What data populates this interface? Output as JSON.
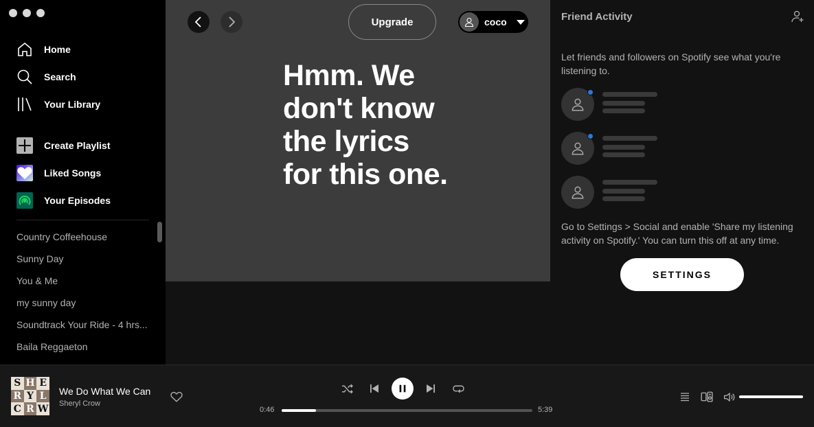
{
  "sidebar": {
    "nav": [
      {
        "label": "Home",
        "icon": "home-icon"
      },
      {
        "label": "Search",
        "icon": "search-icon"
      },
      {
        "label": "Your Library",
        "icon": "library-icon"
      }
    ],
    "actions": [
      {
        "label": "Create Playlist",
        "icon": "plus-icon"
      },
      {
        "label": "Liked Songs",
        "icon": "heart-icon"
      },
      {
        "label": "Your Episodes",
        "icon": "podcast-icon"
      }
    ],
    "playlists": [
      "Country Coffeehouse",
      "Sunny Day",
      "You & Me",
      "my sunny day",
      "Soundtrack Your Ride - 4 hrs...",
      "Baila Reggaeton"
    ]
  },
  "header": {
    "upgrade_label": "Upgrade",
    "user_name": "coco"
  },
  "main": {
    "no_lyrics_message": "Hmm. We don't know the lyrics for this one."
  },
  "friend_activity": {
    "title": "Friend Activity",
    "intro": "Let friends and followers on Spotify see what you're listening to.",
    "outro": "Go to Settings > Social and enable 'Share my listening activity on Spotify.' You can turn this off at any time.",
    "settings_label": "SETTINGS"
  },
  "player": {
    "track_title": "We Do What We Can",
    "artist": "Sheryl Crow",
    "cover_letters": [
      "S",
      "H",
      "E",
      "R",
      "Y",
      "L",
      "C",
      "R",
      "W"
    ],
    "current_time": "0:46",
    "duration": "5:39",
    "progress_fraction": 0.136,
    "volume_fraction": 1.0
  },
  "colors": {
    "accent_blue_dot": "#2e77d0",
    "background": "#121212",
    "lyrics_background": "#3c3c3c"
  }
}
